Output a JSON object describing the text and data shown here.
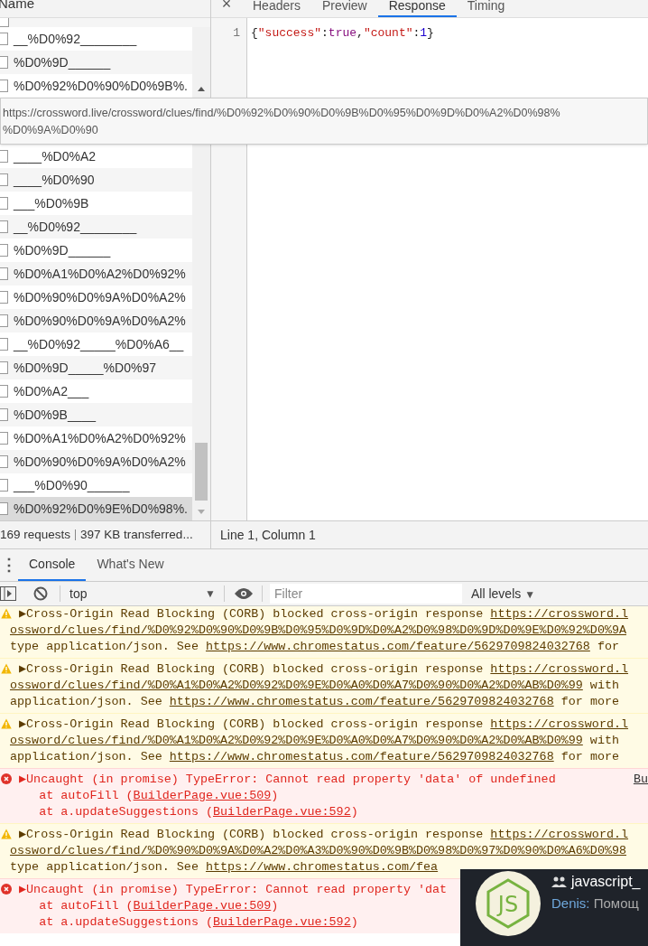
{
  "network": {
    "column_header": "Name",
    "rows": [
      {
        "name": "__%D0%92________",
        "selected": false
      },
      {
        "name": "%D0%9D______",
        "selected": false
      },
      {
        "name": "%D0%92%D0%90%D0%9B%.",
        "selected": false
      },
      {
        "kind": "covered"
      },
      {
        "name": "____%D0%A2",
        "selected": false
      },
      {
        "name": "____%D0%90",
        "selected": false
      },
      {
        "name": "___%D0%9B",
        "selected": false
      },
      {
        "name": "__%D0%92________",
        "selected": false
      },
      {
        "name": "%D0%9D______",
        "selected": false
      },
      {
        "name": "%D0%A1%D0%A2%D0%92%",
        "selected": false
      },
      {
        "name": "%D0%90%D0%9A%D0%A2%",
        "selected": false
      },
      {
        "name": "%D0%90%D0%9A%D0%A2%",
        "selected": false
      },
      {
        "name": "__%D0%92_____%D0%A6__",
        "selected": false
      },
      {
        "name": "%D0%9D_____%D0%97",
        "selected": false
      },
      {
        "name": "%D0%A2___",
        "selected": false
      },
      {
        "name": "%D0%9B____",
        "selected": false
      },
      {
        "name": "%D0%A1%D0%A2%D0%92%",
        "selected": false
      },
      {
        "name": "%D0%90%D0%9A%D0%A2%",
        "selected": false
      },
      {
        "name": "___%D0%90______",
        "selected": false
      },
      {
        "name": "%D0%92%D0%9E%D0%98%.",
        "selected": true
      }
    ],
    "tooltip": [
      "https://crossword.live/crossword/clues/find/%D0%92%D0%90%D0%9B%D0%95%D0%9D%D0%A2%D0%98%",
      "%D0%9A%D0%90"
    ],
    "status": {
      "requests": "169 requests",
      "transferred": "397 KB transferred..."
    }
  },
  "detail": {
    "close": "×",
    "tabs": [
      {
        "label": "Headers",
        "selected": false
      },
      {
        "label": "Preview",
        "selected": false
      },
      {
        "label": "Response",
        "selected": true
      },
      {
        "label": "Timing",
        "selected": false
      }
    ],
    "code_lines": [
      {
        "number": "1",
        "tokens": [
          {
            "text": "{"
          },
          {
            "text": "\"success\"",
            "color": "#c41a16"
          },
          {
            "text": ":"
          },
          {
            "text": "true",
            "color": "#881280"
          },
          {
            "text": ","
          },
          {
            "text": "\"count\"",
            "color": "#c41a16"
          },
          {
            "text": ":"
          },
          {
            "text": "1",
            "color": "#1c00cf"
          },
          {
            "text": "}"
          }
        ]
      }
    ],
    "cursor": "Line 1, Column 1"
  },
  "drawer": {
    "menu": "⋮",
    "tabs": [
      {
        "label": "Console",
        "selected": true
      },
      {
        "label": "What's New",
        "selected": false
      }
    ]
  },
  "toolbar": {
    "context": "top",
    "context_caret": "▼",
    "filter_placeholder": "Filter",
    "levels": "All levels",
    "levels_caret": "▼"
  },
  "messages": [
    {
      "kind": "warning",
      "lines": [
        [
          {
            "text": "▶Cross-Origin Read Blocking (CORB) blocked cross-origin response ",
            "kind": "text"
          },
          {
            "text": "https://crossword.l",
            "kind": "link"
          }
        ],
        [
          {
            "text": "ossword/clues/find/%D0%92%D0%90%D0%9B%D0%95%D0%9D%D0%A2%D0%98%D0%9D%D0%9E%D0%92%D0%9A",
            "kind": "link"
          }
        ],
        [
          {
            "text": "type application/json. See ",
            "kind": "text"
          },
          {
            "text": "https://www.chromestatus.com/feature/5629709824032768",
            "kind": "link"
          },
          {
            "text": " for",
            "kind": "text"
          }
        ]
      ]
    },
    {
      "kind": "warning",
      "lines": [
        [
          {
            "text": "▶Cross-Origin Read Blocking (CORB) blocked cross-origin response ",
            "kind": "text"
          },
          {
            "text": "https://crossword.l",
            "kind": "link"
          }
        ],
        [
          {
            "text": "ossword/clues/find/%D0%A1%D0%A2%D0%92%D0%9E%D0%A0%D0%A7%D0%90%D0%A2%D0%AB%D0%99",
            "kind": "link"
          },
          {
            "text": " with",
            "kind": "text"
          }
        ],
        [
          {
            "text": "application/json. See ",
            "kind": "text"
          },
          {
            "text": "https://www.chromestatus.com/feature/5629709824032768",
            "kind": "link"
          },
          {
            "text": " for more",
            "kind": "text"
          }
        ]
      ]
    },
    {
      "kind": "warning",
      "lines": [
        [
          {
            "text": "▶Cross-Origin Read Blocking (CORB) blocked cross-origin response ",
            "kind": "text"
          },
          {
            "text": "https://crossword.l",
            "kind": "link"
          }
        ],
        [
          {
            "text": "ossword/clues/find/%D0%A1%D0%A2%D0%92%D0%9E%D0%A0%D0%A7%D0%90%D0%A2%D0%AB%D0%99",
            "kind": "link"
          },
          {
            "text": " with",
            "kind": "text"
          }
        ],
        [
          {
            "text": "application/json. See ",
            "kind": "text"
          },
          {
            "text": "https://www.chromestatus.com/feature/5629709824032768",
            "kind": "link"
          },
          {
            "text": " for more",
            "kind": "text"
          }
        ]
      ]
    },
    {
      "kind": "error",
      "source": "Bu",
      "lines": [
        [
          {
            "text": "▶Uncaught (in promise) TypeError: Cannot read property 'data' of undefined",
            "kind": "text"
          }
        ],
        [
          {
            "text": "    at autoFill (",
            "kind": "text"
          },
          {
            "text": "BuilderPage.vue:509",
            "kind": "link"
          },
          {
            "text": ")",
            "kind": "text"
          }
        ],
        [
          {
            "text": "    at a.updateSuggestions (",
            "kind": "text"
          },
          {
            "text": "BuilderPage.vue:592",
            "kind": "link"
          },
          {
            "text": ")",
            "kind": "text"
          }
        ]
      ]
    },
    {
      "kind": "warning",
      "lines": [
        [
          {
            "text": "▶Cross-Origin Read Blocking (CORB) blocked cross-origin response ",
            "kind": "text"
          },
          {
            "text": "https://crossword.l",
            "kind": "link"
          }
        ],
        [
          {
            "text": "ossword/clues/find/%D0%90%D0%9A%D0%A2%D0%A3%D0%90%D0%9B%D0%98%D0%97%D0%90%D0%A6%D0%98",
            "kind": "link"
          }
        ],
        [
          {
            "text": "type application/json. See ",
            "kind": "text"
          },
          {
            "text": "https://www.chromestatus.com/fea",
            "kind": "link"
          }
        ]
      ]
    },
    {
      "kind": "error",
      "lines": [
        [
          {
            "text": "▶Uncaught (in promise) TypeError: Cannot read property 'dat",
            "kind": "text"
          }
        ],
        [
          {
            "text": "    at autoFill (",
            "kind": "text"
          },
          {
            "text": "BuilderPage.vue:509",
            "kind": "link"
          },
          {
            "text": ")",
            "kind": "text"
          }
        ],
        [
          {
            "text": "    at a.updateSuggestions (",
            "kind": "text"
          },
          {
            "text": "BuilderPage.vue:592",
            "kind": "link"
          },
          {
            "text": ")",
            "kind": "text"
          }
        ]
      ]
    }
  ],
  "notification": {
    "logo": "JS",
    "title": "javascript_",
    "sender": "Denis:",
    "preview": "Помощ"
  }
}
